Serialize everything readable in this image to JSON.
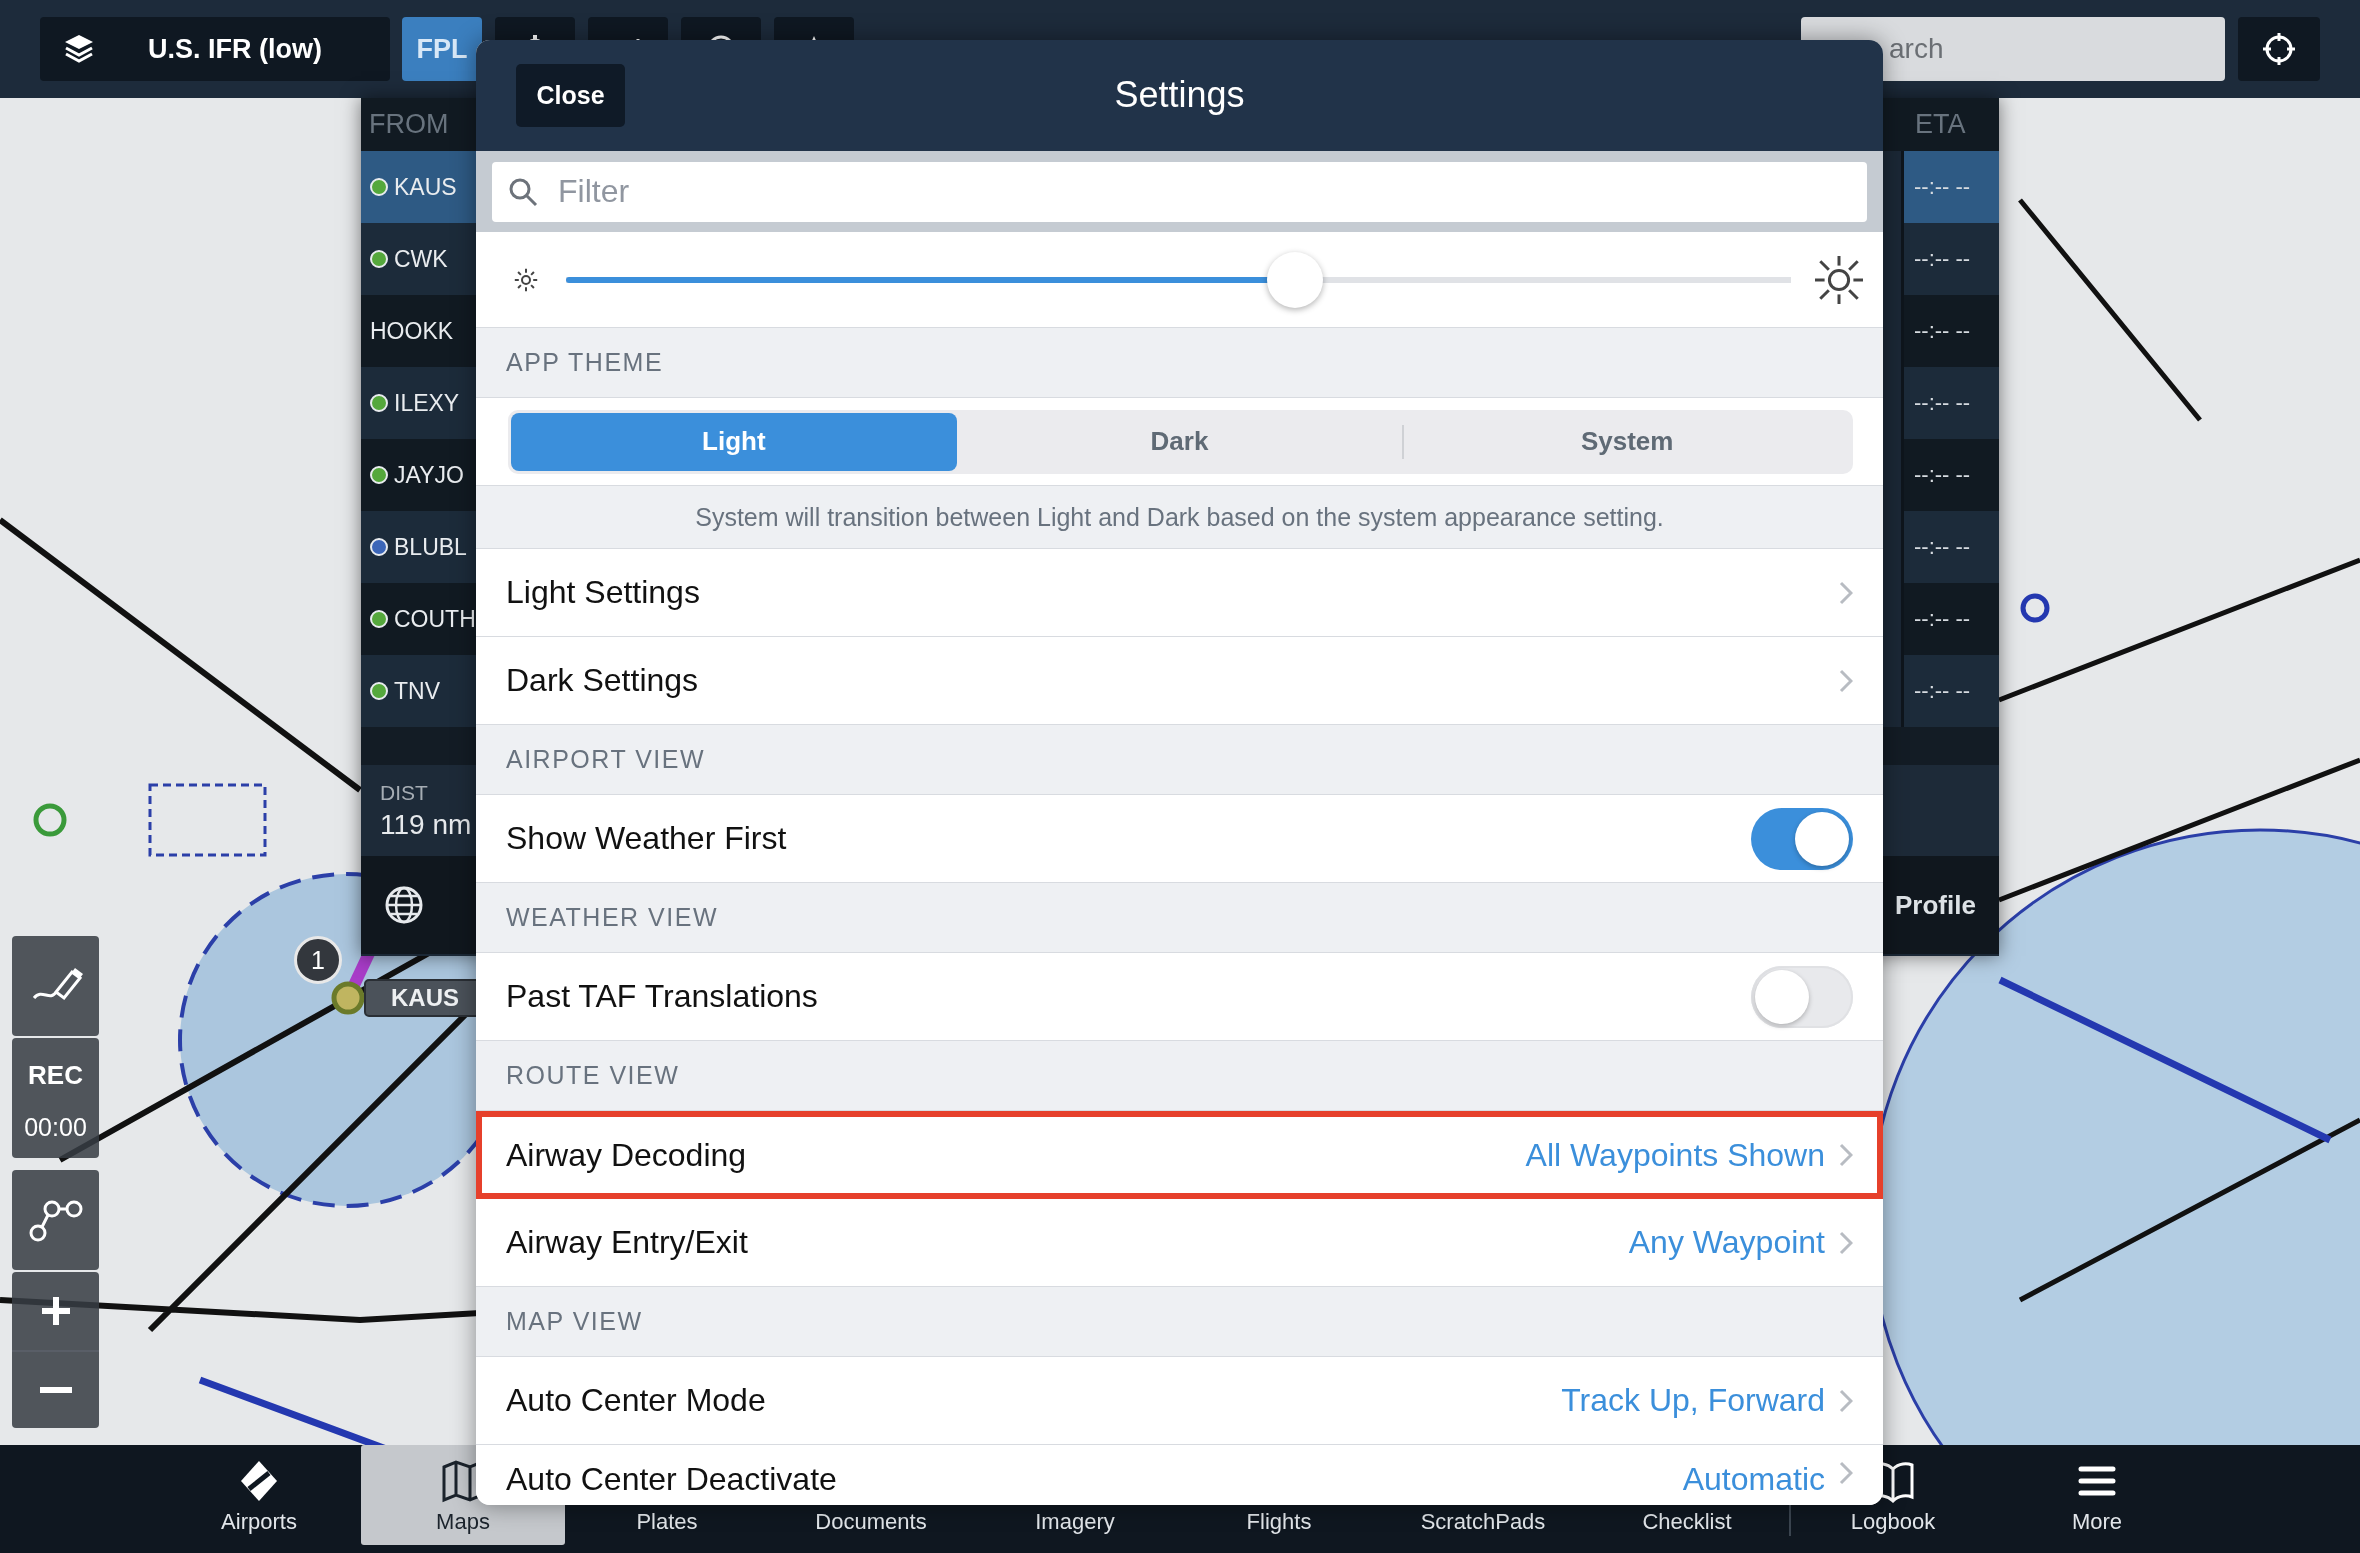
{
  "top_bar": {
    "layers_label": "U.S. IFR (low)",
    "tools": [
      {
        "kind": "text",
        "label": "FPL",
        "selected": true
      },
      {
        "kind": "gear",
        "selected": false
      },
      {
        "kind": "bar-arrow",
        "selected": false
      },
      {
        "kind": "ring",
        "selected": false
      },
      {
        "kind": "star",
        "selected": false
      }
    ],
    "search": {
      "placeholder": "arch"
    }
  },
  "flight_plan": {
    "from_header": "FROM",
    "eta_header": "ETA",
    "waypoints": [
      {
        "name": "KAUS",
        "selected": true,
        "color": "#55a83c",
        "eta": "--:-- --"
      },
      {
        "name": "CWK",
        "selected": false,
        "color": "#55a83c",
        "eta": "--:-- --"
      },
      {
        "name": "HOOKK",
        "selected": false,
        "eta": "--:-- --"
      },
      {
        "name": "ILEXY",
        "selected": false,
        "color": "#55a83c",
        "eta": "--:-- --"
      },
      {
        "name": "JAYJO",
        "selected": false,
        "color": "#55a83c",
        "eta": "--:-- --"
      },
      {
        "name": "BLUBL",
        "selected": false,
        "color": "#3c66b8",
        "eta": "--:-- --"
      },
      {
        "name": "COUTH",
        "selected": false,
        "color": "#55a83c",
        "eta": "--:-- --"
      },
      {
        "name": "TNV",
        "selected": false,
        "color": "#55a83c",
        "eta": "--:-- --"
      }
    ],
    "dist_label": "DIST",
    "dist_value": "119 nm",
    "profile": "Profile"
  },
  "map": {
    "marker": "1",
    "airport_label": "KAUS"
  },
  "map_controls": {
    "rec": "REC",
    "timer": "00:00"
  },
  "settings": {
    "close": "Close",
    "title": "Settings",
    "filter_placeholder": "Filter",
    "brightness": {
      "level": 0.595
    },
    "rows": [
      {
        "kind": "header",
        "label": "APP THEME"
      },
      {
        "kind": "segmented",
        "options": [
          {
            "label": "Light",
            "selected": true
          },
          {
            "label": "Dark",
            "selected": false
          },
          {
            "label": "System",
            "selected": false
          }
        ]
      },
      {
        "kind": "note",
        "label": "System will transition between Light and Dark based on the system appearance setting."
      },
      {
        "kind": "link",
        "label": "Light Settings",
        "highlighted": false
      },
      {
        "kind": "link",
        "label": "Dark Settings",
        "highlighted": false
      },
      {
        "kind": "header",
        "label": "AIRPORT VIEW"
      },
      {
        "kind": "toggle",
        "label": "Show Weather First",
        "on": true
      },
      {
        "kind": "header",
        "label": "WEATHER VIEW"
      },
      {
        "kind": "toggle",
        "label": "Past TAF Translations",
        "on": false
      },
      {
        "kind": "header",
        "label": "ROUTE VIEW"
      },
      {
        "kind": "link",
        "label": "Airway Decoding",
        "value": "All Waypoints Shown",
        "highlighted": true
      },
      {
        "kind": "link",
        "label": "Airway Entry/Exit",
        "value": "Any Waypoint",
        "highlighted": false
      },
      {
        "kind": "header",
        "label": "MAP VIEW"
      },
      {
        "kind": "link",
        "label": "Auto Center Mode",
        "value": "Track Up, Forward",
        "highlighted": false
      },
      {
        "kind": "link",
        "label": "Auto Center Deactivate",
        "value": "Automatic",
        "highlighted": false
      }
    ]
  },
  "tab_bar": [
    {
      "label": "Airports",
      "selected": false
    },
    {
      "label": "Maps",
      "selected": true
    },
    {
      "label": "Plates",
      "selected": false
    },
    {
      "label": "Documents",
      "selected": false
    },
    {
      "label": "Imagery",
      "selected": false
    },
    {
      "label": "Flights",
      "selected": false
    },
    {
      "label": "ScratchPads",
      "selected": false
    },
    {
      "label": "Checklist",
      "selected": false
    },
    {
      "label": "Logbook",
      "selected": false
    },
    {
      "label": "More",
      "selected": false
    }
  ]
}
